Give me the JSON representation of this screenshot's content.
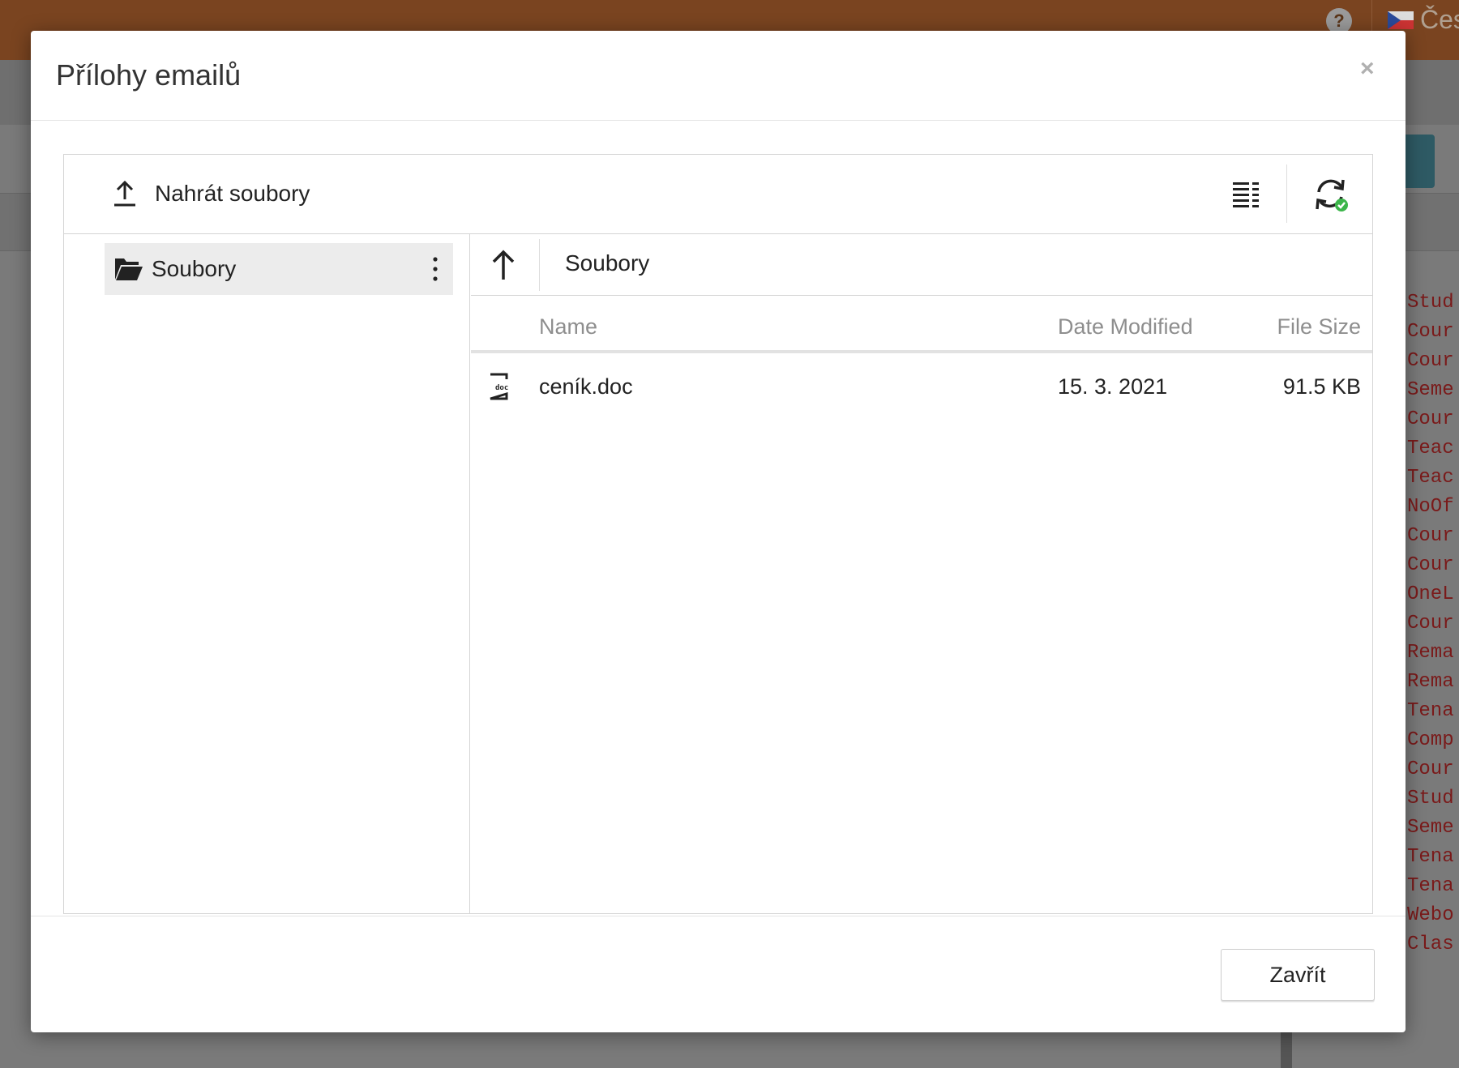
{
  "background": {
    "language": "Čes",
    "help_icon": "?",
    "code_lines": [
      "Stud",
      "Cour",
      "Cour",
      "Seme",
      "Cour",
      "Teac",
      "Teac",
      "NoOf",
      "Cour",
      "Cour",
      "OneL",
      "Cour",
      "Rema",
      "Rema",
      "Tena",
      "Comp",
      "Cour",
      "Stud",
      "Seme",
      "Tena",
      "Tena",
      "Webo",
      "Clas"
    ]
  },
  "modal": {
    "title": "Přílohy emailů",
    "close_symbol": "×"
  },
  "toolbar": {
    "upload_label": "Nahrát soubory"
  },
  "tree": {
    "root_label": "Soubory"
  },
  "breadcrumb": {
    "current": "Soubory"
  },
  "columns": {
    "name": "Name",
    "date": "Date Modified",
    "size": "File Size"
  },
  "files": [
    {
      "name": "ceník.doc",
      "date": "15. 3. 2021",
      "size": "91.5 KB",
      "icon": "doc-file-icon"
    }
  ],
  "footer": {
    "close_label": "Zavřít"
  },
  "colors": {
    "topbar": "#7a4420",
    "refresh_ok": "#3cb54a"
  }
}
